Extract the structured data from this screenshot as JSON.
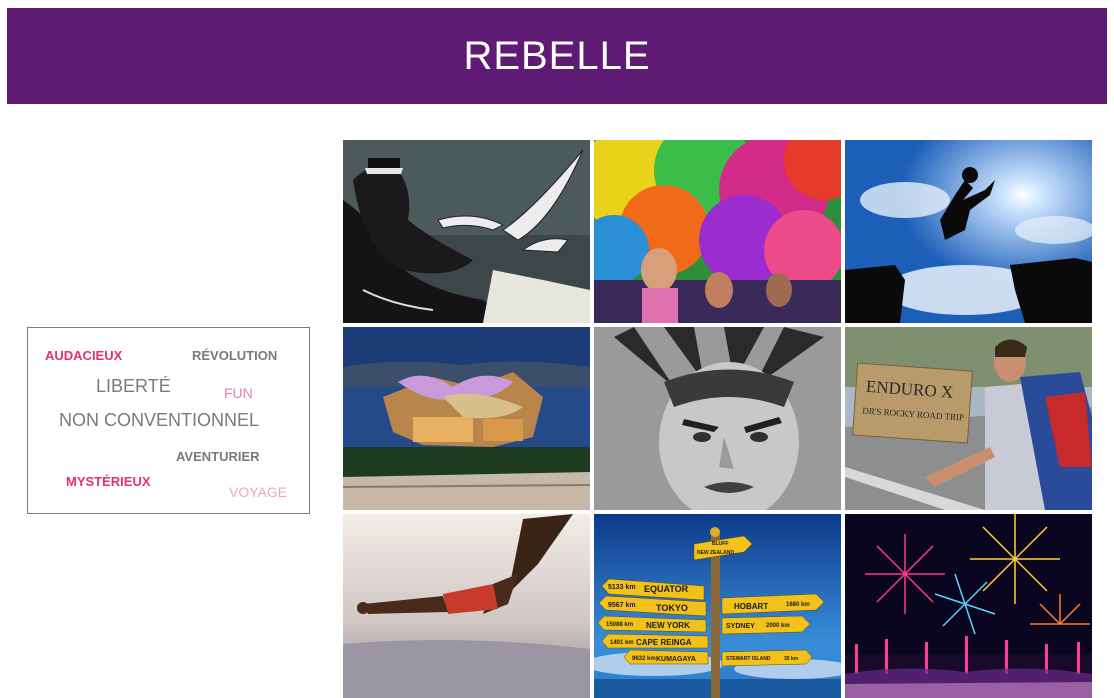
{
  "header": {
    "title": "REBELLE",
    "color": "#5f1a73"
  },
  "word_cloud": {
    "words": [
      {
        "text": "AUDACIEUX",
        "color": "#e2336e"
      },
      {
        "text": "RÉVOLUTION",
        "color": "#7a7a7a"
      },
      {
        "text": "LIBERTÉ",
        "color": "#7a7a7a"
      },
      {
        "text": "FUN",
        "color": "#e87ab8"
      },
      {
        "text": "NON CONVENTIONNEL",
        "color": "#7a7a7a"
      },
      {
        "text": "AVENTURIER",
        "color": "#7a7a7a"
      },
      {
        "text": "MYSTÉRIEUX",
        "color": "#e2336e"
      },
      {
        "text": "VOYAGE",
        "color": "#eea2c8"
      }
    ]
  },
  "signpost": {
    "nz": "NEW ZEALAND",
    "bluff": "BLUFF",
    "equator_dist": "5133 km",
    "equator": "EQUATOR",
    "tokyo_dist": "9567 km",
    "tokyo": "TOKYO",
    "hobart": "HOBART",
    "hobart_dist": "1680 km",
    "ny_dist": "15088 km",
    "ny": "NEW YORK",
    "sydney": "SYDNEY",
    "sydney_dist": "2000 km",
    "cape_dist": "1401 km",
    "cape": "CAPE REINGA",
    "kuma_dist": "9632 km",
    "kuma": "KUMAGAYA",
    "stewart": "STEWART ISLAND",
    "stewart_dist": "35 km"
  },
  "sign_board": {
    "line1": "ENDURO X",
    "line2": "DR'S ROCKY ROAD TRIP"
  }
}
